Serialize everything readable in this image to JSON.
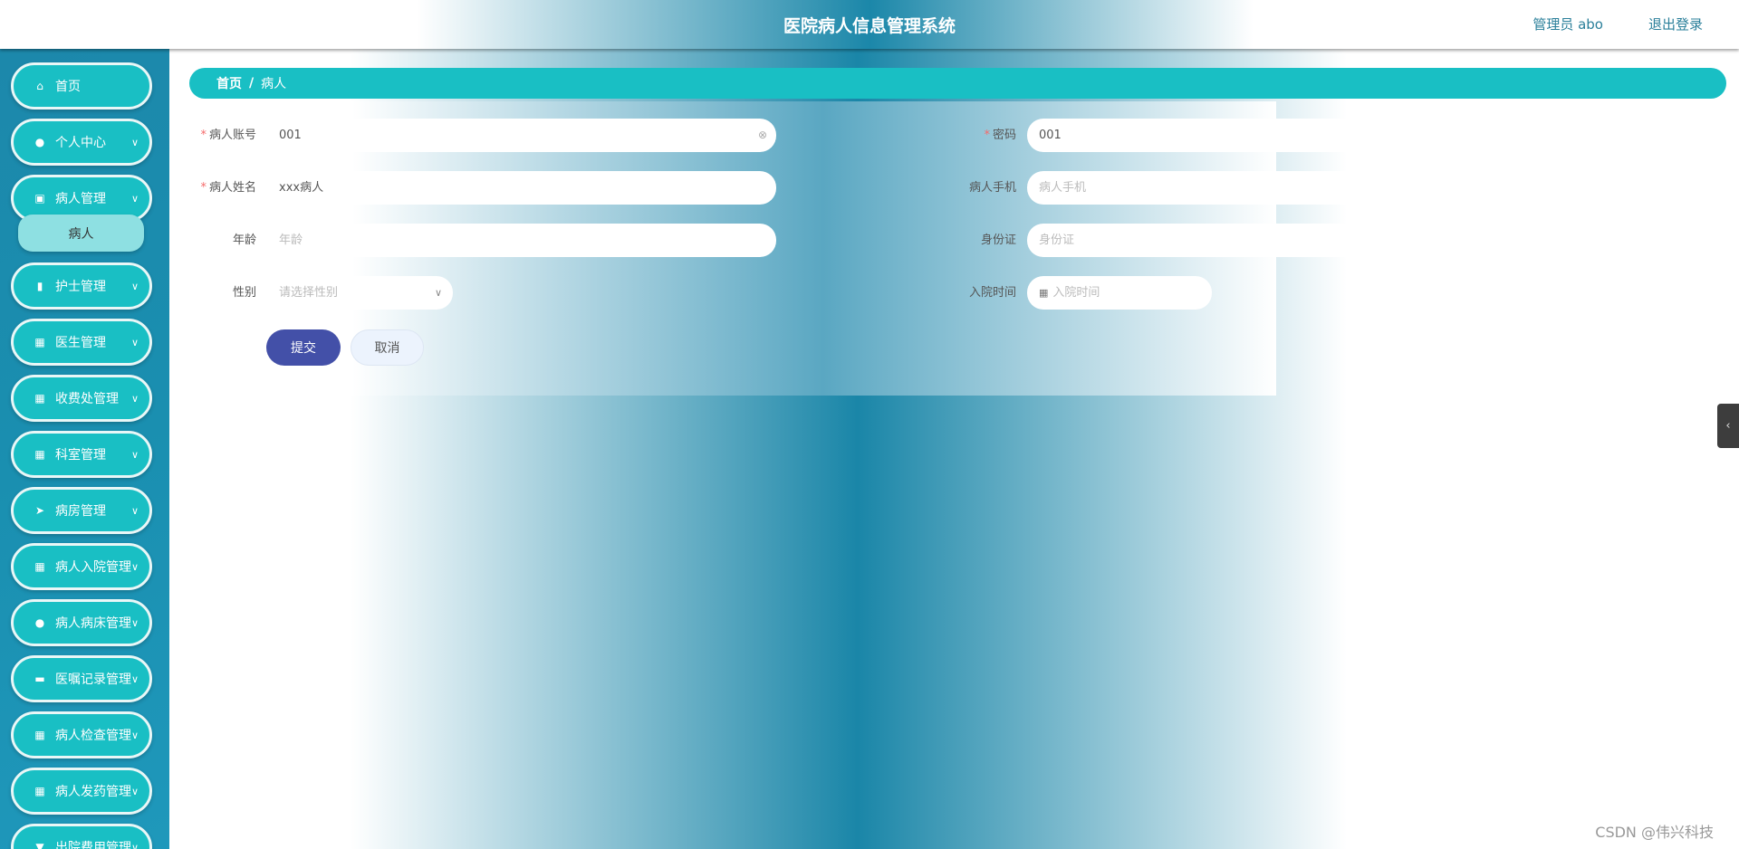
{
  "header": {
    "title": "医院病人信息管理系统",
    "user": "管理员 abo",
    "logout": "退出登录"
  },
  "sidebar": {
    "items": [
      {
        "label": "首页",
        "icon": "home-icon",
        "glyph": "⌂",
        "chevron": false
      },
      {
        "label": "个人中心",
        "icon": "user-icon",
        "glyph": "●",
        "chevron": true
      },
      {
        "label": "病人管理",
        "icon": "chart-icon",
        "glyph": "▣",
        "chevron": true
      },
      {
        "label": "护士管理",
        "icon": "clipboard-icon",
        "glyph": "▮",
        "chevron": true
      },
      {
        "label": "医生管理",
        "icon": "grid-icon",
        "glyph": "▦",
        "chevron": true
      },
      {
        "label": "收费处管理",
        "icon": "grid-icon",
        "glyph": "▦",
        "chevron": true
      },
      {
        "label": "科室管理",
        "icon": "table-icon",
        "glyph": "▦",
        "chevron": true
      },
      {
        "label": "病房管理",
        "icon": "paper-plane-icon",
        "glyph": "➤",
        "chevron": true
      },
      {
        "label": "病人入院管理",
        "icon": "grid-icon",
        "glyph": "▦",
        "chevron": true
      },
      {
        "label": "病人病床管理",
        "icon": "user-icon",
        "glyph": "●",
        "chevron": true
      },
      {
        "label": "医嘱记录管理",
        "icon": "monitor-icon",
        "glyph": "▬",
        "chevron": true
      },
      {
        "label": "病人检查管理",
        "icon": "grid-icon",
        "glyph": "▦",
        "chevron": true
      },
      {
        "label": "病人发药管理",
        "icon": "grid-icon",
        "glyph": "▦",
        "chevron": true
      },
      {
        "label": "出院费用管理",
        "icon": "menu-icon",
        "glyph": "▼",
        "chevron": true
      }
    ],
    "sub_item": "病人"
  },
  "breadcrumb": {
    "home": "首页",
    "sep": "/",
    "current": "病人"
  },
  "form": {
    "account": {
      "label": "病人账号",
      "required": true,
      "value": "001"
    },
    "password": {
      "label": "密码",
      "required": true,
      "value": "001"
    },
    "name": {
      "label": "病人姓名",
      "required": true,
      "value": "xxx病人"
    },
    "phone": {
      "label": "病人手机",
      "placeholder": "病人手机"
    },
    "age": {
      "label": "年龄",
      "placeholder": "年龄"
    },
    "idcard": {
      "label": "身份证",
      "placeholder": "身份证"
    },
    "gender": {
      "label": "性别",
      "placeholder": "请选择性别"
    },
    "admit": {
      "label": "入院时间",
      "placeholder": "入院时间"
    },
    "submit": "提交",
    "cancel": "取消"
  },
  "watermark": "CSDN @伟兴科技",
  "colors": {
    "accent": "#19bfc4",
    "submit": "#4350a8",
    "sidebar": "#1c88ab"
  }
}
